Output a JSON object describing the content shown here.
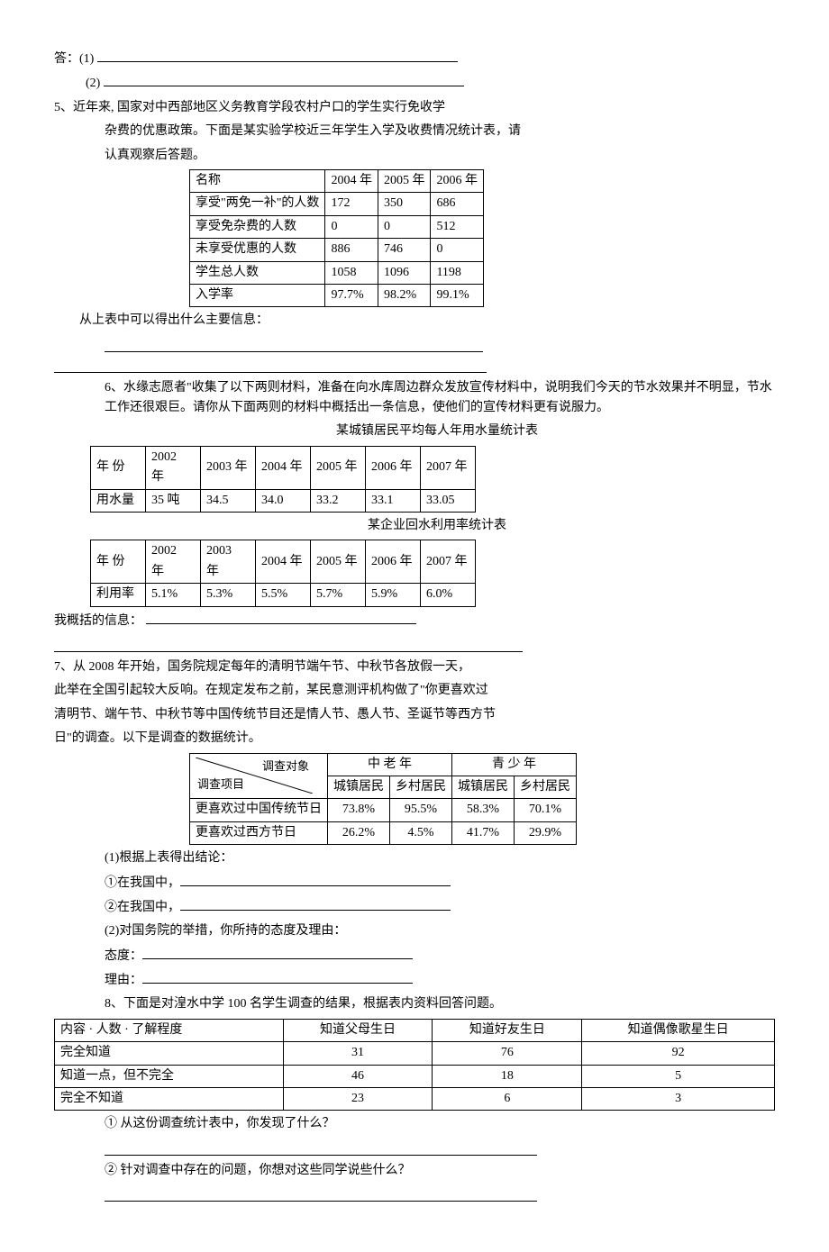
{
  "intro": {
    "ans_label": "答：(1)",
    "ans_label2": "(2)"
  },
  "q5": {
    "num": "5、近年来, 国家对中西部地区义务教育学段农村户口的学生实行免收学",
    "line2": "杂费的优惠政策。下面是某实验学校近三年学生入学及收费情况统计表，请",
    "line3": "认真观察后答题。",
    "headers": [
      "名称",
      "2004 年",
      "2005 年",
      "2006 年"
    ],
    "rows": [
      [
        "享受\"两免一补\"的人数",
        "172",
        "350",
        "686"
      ],
      [
        "享受免杂费的人数",
        "0",
        "0",
        "512"
      ],
      [
        "未享受优惠的人数",
        "886",
        "746",
        "0"
      ],
      [
        "学生总人数",
        "1058",
        "1096",
        "1198"
      ],
      [
        "入学率",
        "97.7%",
        "98.2%",
        "99.1%"
      ]
    ],
    "prompt": "从上表中可以得出什么主要信息："
  },
  "q6": {
    "intro": "6、水缘志愿者\"收集了以下两则材料，准备在向水库周边群众发放宣传材料中，说明我们今天的节水效果并不明显，节水工作还很艰巨。请你从下面两则的材料中概括出一条信息，使他们的宣传材料更有说服力。",
    "cap1": "某城镇居民平均每人年用水量统计表",
    "t1_h": [
      "年 份",
      "2002\n年",
      "2003 年",
      "2004 年",
      "2005 年",
      "2006 年",
      "2007 年"
    ],
    "t1_r": [
      "用水量",
      "35 吨",
      "34.5",
      "34.0",
      "33.2",
      "33.1",
      "33.05"
    ],
    "cap2": "某企业回水利用率统计表",
    "t2_h": [
      "年 份",
      "2002\n年",
      "2003\n年",
      "2004 年",
      "2005 年",
      "2006 年",
      "2007 年"
    ],
    "t2_r": [
      "利用率",
      "5.1%",
      "5.3%",
      "5.5%",
      "5.7%",
      "5.9%",
      "6.0%"
    ],
    "prompt": "我概括的信息："
  },
  "q7": {
    "l1": "7、从 2008 年开始，国务院规定每年的清明节端午节、中秋节各放假一天，",
    "l2": "此举在全国引起较大反响。在规定发布之前，某民意测评机构做了\"你更喜欢过",
    "l3": "清明节、端午节、中秋节等中国传统节目还是情人节、愚人节、圣诞节等西方节",
    "l4": "日\"的调查。以下是调查的数据统计。",
    "diag_top": "调查对象",
    "diag_bot": "调查项目",
    "col_groups": [
      "中 老 年",
      "青 少 年"
    ],
    "subcols": [
      "城镇居民",
      "乡村居民",
      "城镇居民",
      "乡村居民"
    ],
    "rows": [
      [
        "更喜欢过中国传统节日",
        "73.8%",
        "95.5%",
        "58.3%",
        "70.1%"
      ],
      [
        "更喜欢过西方节日",
        "26.2%",
        "4.5%",
        "41.7%",
        "29.9%"
      ]
    ],
    "p1": "(1)根据上表得出结论：",
    "p1a": "①在我国中，",
    "p1b": "②在我国中，",
    "p2": "(2)对国务院的举措，你所持的态度及理由：",
    "p2a": "态度：",
    "p2b": "理由："
  },
  "q8": {
    "intro": "8、下面是对湟水中学 100 名学生调查的结果，根据表内资料回答问题。",
    "headers": [
      "内容 · 人数 · 了解程度",
      "知道父母生日",
      "知道好友生日",
      "知道偶像歌星生日"
    ],
    "rows": [
      [
        "完全知道",
        "31",
        "76",
        "92"
      ],
      [
        "知道一点，但不完全",
        "46",
        "18",
        "5"
      ],
      [
        "完全不知道",
        "23",
        "6",
        "3"
      ]
    ],
    "q1": "① 从这份调查统计表中，你发现了什么？",
    "q2": "② 针对调查中存在的问题，你想对这些同学说些什么？"
  }
}
